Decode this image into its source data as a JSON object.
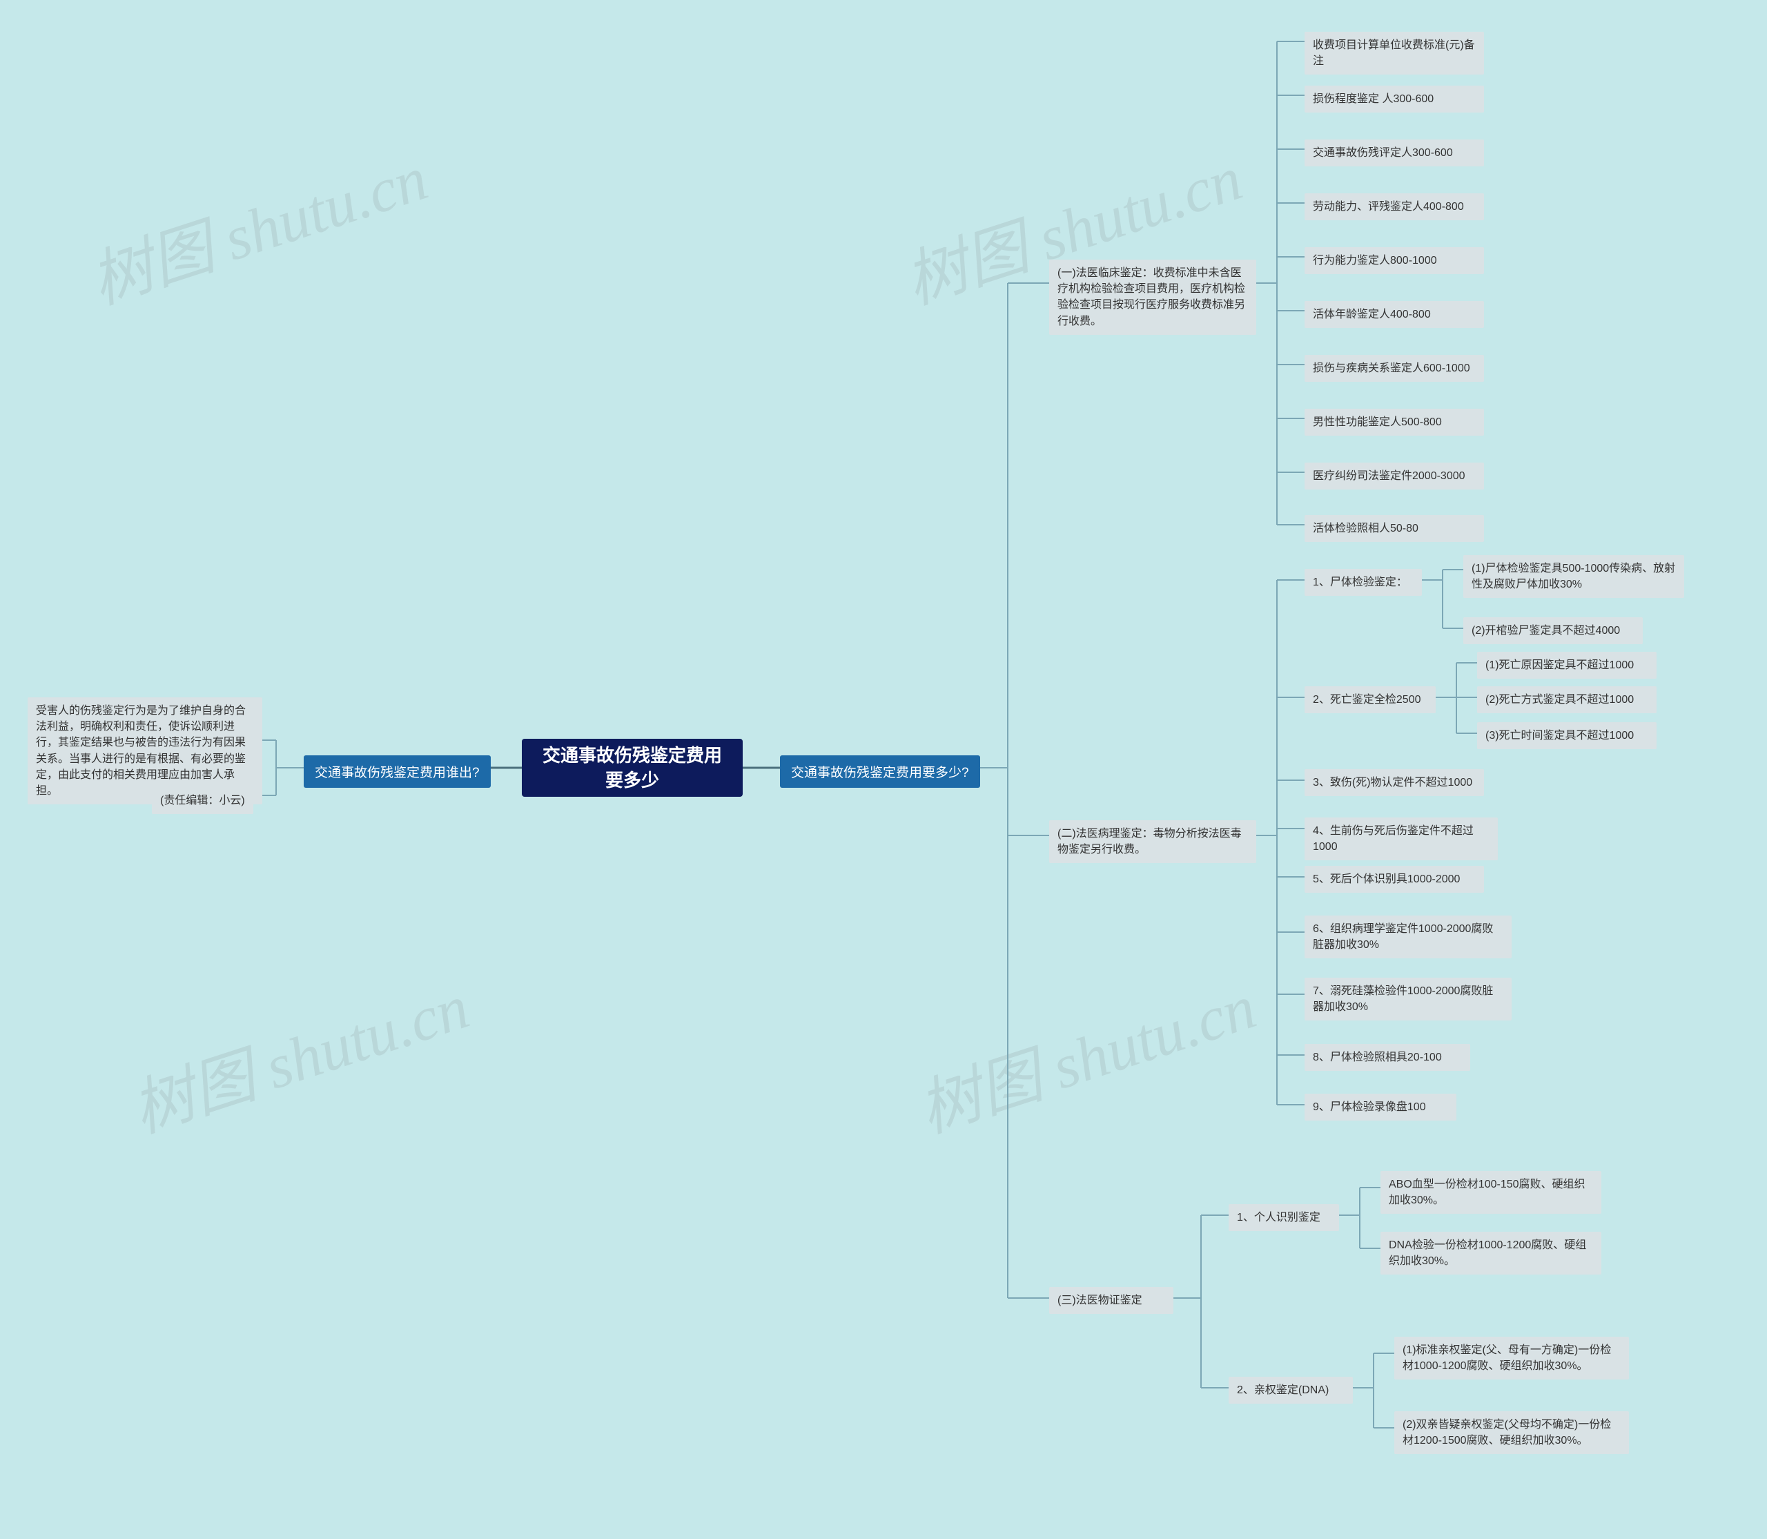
{
  "watermark": "树图 shutu.cn",
  "root": "交通事故伤残鉴定费用要多少",
  "left": {
    "q": "交通事故伤残鉴定费用谁出?",
    "a1": "受害人的伤残鉴定行为是为了维护自身的合法利益，明确权利和责任，使诉讼顺利进行，其鉴定结果也与被告的违法行为有因果关系。当事人进行的是有根据、有必要的鉴定，由此支付的相关费用理应由加害人承担。",
    "a2": "(责任编辑：小云)"
  },
  "right": {
    "q": "交通事故伤残鉴定费用要多少?",
    "s1": {
      "title": "(一)法医临床鉴定：收费标准中未含医疗机构检验检查项目费用，医疗机构检验检查项目按现行医疗服务收费标准另行收费。",
      "rows": [
        "收费项目计算单位收费标准(元)备注",
        "损伤程度鉴定 人300-600",
        "交通事故伤残评定人300-600",
        "劳动能力、评残鉴定人400-800",
        "行为能力鉴定人800-1000",
        "活体年龄鉴定人400-800",
        "损伤与疾病关系鉴定人600-1000",
        "男性性功能鉴定人500-800",
        "医疗纠纷司法鉴定件2000-3000",
        "活体检验照相人50-80"
      ]
    },
    "s2": {
      "title": "(二)法医病理鉴定：毒物分析按法医毒物鉴定另行收费。",
      "n1": {
        "label": "1、尸体检验鉴定：",
        "c1": "(1)尸体检验鉴定具500-1000传染病、放射性及腐败尸体加收30%",
        "c2": "(2)开棺验尸鉴定具不超过4000"
      },
      "n2": {
        "label": "2、死亡鉴定全检2500",
        "c1": "(1)死亡原因鉴定具不超过1000",
        "c2": "(2)死亡方式鉴定具不超过1000",
        "c3": "(3)死亡时间鉴定具不超过1000"
      },
      "n3": "3、致伤(死)物认定件不超过1000",
      "n4": "4、生前伤与死后伤鉴定件不超过1000",
      "n5": "5、死后个体识别具1000-2000",
      "n6": "6、组织病理学鉴定件1000-2000腐败脏器加收30%",
      "n7": "7、溺死硅藻检验件1000-2000腐败脏器加收30%",
      "n8": "8、尸体检验照相具20-100",
      "n9": "9、尸体检验录像盘100"
    },
    "s3": {
      "title": "(三)法医物证鉴定",
      "g1": {
        "label": "1、个人识别鉴定",
        "c1": "ABO血型一份检材100-150腐败、硬组织加收30%。",
        "c2": "DNA检验一份检材1000-1200腐败、硬组织加收30%。"
      },
      "g2": {
        "label": "2、亲权鉴定(DNA)",
        "c1": "(1)标准亲权鉴定(父、母有一方确定)一份检材1000-1200腐败、硬组织加收30%。",
        "c2": "(2)双亲皆疑亲权鉴定(父母均不确定)一份检材1200-1500腐败、硬组织加收30%。"
      }
    }
  }
}
